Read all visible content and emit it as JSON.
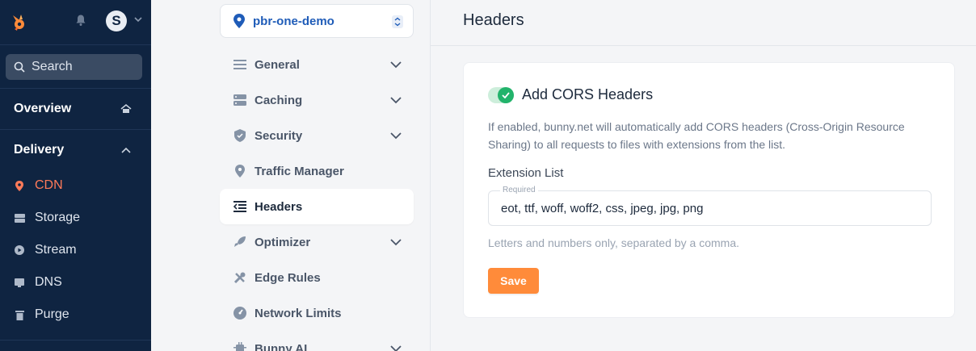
{
  "sidebar": {
    "search_placeholder": "Search",
    "avatar_letter": "S",
    "sections": {
      "overview": "Overview",
      "delivery": "Delivery"
    },
    "items": [
      {
        "label": "CDN",
        "icon": "pin-icon",
        "active": true
      },
      {
        "label": "Storage",
        "icon": "storage-icon",
        "active": false
      },
      {
        "label": "Stream",
        "icon": "play-icon",
        "active": false
      },
      {
        "label": "DNS",
        "icon": "dns-icon",
        "active": false
      },
      {
        "label": "Purge",
        "icon": "trash-icon",
        "active": false
      }
    ]
  },
  "middle": {
    "zone_name": "pbr-one-demo",
    "nav": [
      {
        "label": "General",
        "icon": "list-icon",
        "expandable": true,
        "active": false
      },
      {
        "label": "Caching",
        "icon": "server-icon",
        "expandable": true,
        "active": false
      },
      {
        "label": "Security",
        "icon": "shield-icon",
        "expandable": true,
        "active": false
      },
      {
        "label": "Traffic Manager",
        "icon": "pin-icon",
        "expandable": false,
        "active": false
      },
      {
        "label": "Headers",
        "icon": "headers-icon",
        "expandable": false,
        "active": true
      },
      {
        "label": "Optimizer",
        "icon": "rocket-icon",
        "expandable": true,
        "active": false
      },
      {
        "label": "Edge Rules",
        "icon": "tools-icon",
        "expandable": false,
        "active": false
      },
      {
        "label": "Network Limits",
        "icon": "gauge-icon",
        "expandable": false,
        "active": false
      },
      {
        "label": "Bunny AI",
        "icon": "chip-icon",
        "expandable": true,
        "active": false
      }
    ]
  },
  "content": {
    "page_title": "Headers",
    "cors": {
      "enabled": true,
      "title": "Add CORS Headers",
      "description": "If enabled, bunny.net will automatically add CORS headers (Cross-Origin Resource Sharing) to all requests to files with extensions from the list.",
      "extension_label": "Extension List",
      "required_label": "Required",
      "extension_value": "eot, ttf, woff, woff2, css, jpeg, jpg, png",
      "hint": "Letters and numbers only, separated by a comma.",
      "save_label": "Save"
    }
  },
  "colors": {
    "sidebar_bg": "#0f2441",
    "accent_orange": "#ff8b3a",
    "active_red": "#ff7a59",
    "toggle_green": "#22b36b",
    "zone_blue": "#1f5cb8"
  }
}
